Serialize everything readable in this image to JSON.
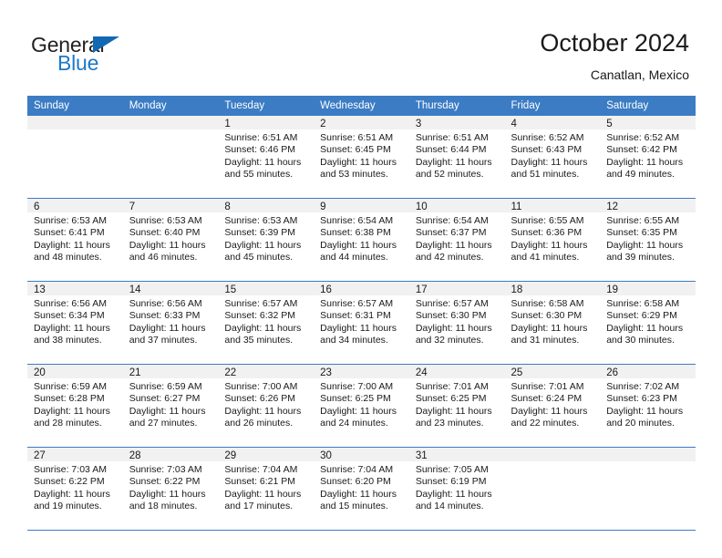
{
  "brand": {
    "name_part1": "General",
    "name_part2": "Blue",
    "triangle_icon": "triangle-icon",
    "accent_color": "#1268b3",
    "blue_text_color": "#1c78c8"
  },
  "header": {
    "title": "October 2024",
    "subtitle": "Canatlan, Mexico"
  },
  "theme": {
    "header_row_bg": "#3b7cc4",
    "date_strip_bg": "#f1f1f1",
    "row_divider": "#3b7cc4",
    "text_color": "#1a1a1a"
  },
  "weekdays": [
    "Sunday",
    "Monday",
    "Tuesday",
    "Wednesday",
    "Thursday",
    "Friday",
    "Saturday"
  ],
  "weeks": [
    [
      {
        "empty": true
      },
      {
        "empty": true
      },
      {
        "empty": false,
        "date": "1",
        "sunrise": "Sunrise: 6:51 AM",
        "sunset": "Sunset: 6:46 PM",
        "daylight_line1": "Daylight: 11 hours",
        "daylight_line2": "and 55 minutes."
      },
      {
        "empty": false,
        "date": "2",
        "sunrise": "Sunrise: 6:51 AM",
        "sunset": "Sunset: 6:45 PM",
        "daylight_line1": "Daylight: 11 hours",
        "daylight_line2": "and 53 minutes."
      },
      {
        "empty": false,
        "date": "3",
        "sunrise": "Sunrise: 6:51 AM",
        "sunset": "Sunset: 6:44 PM",
        "daylight_line1": "Daylight: 11 hours",
        "daylight_line2": "and 52 minutes."
      },
      {
        "empty": false,
        "date": "4",
        "sunrise": "Sunrise: 6:52 AM",
        "sunset": "Sunset: 6:43 PM",
        "daylight_line1": "Daylight: 11 hours",
        "daylight_line2": "and 51 minutes."
      },
      {
        "empty": false,
        "date": "5",
        "sunrise": "Sunrise: 6:52 AM",
        "sunset": "Sunset: 6:42 PM",
        "daylight_line1": "Daylight: 11 hours",
        "daylight_line2": "and 49 minutes."
      }
    ],
    [
      {
        "empty": false,
        "date": "6",
        "sunrise": "Sunrise: 6:53 AM",
        "sunset": "Sunset: 6:41 PM",
        "daylight_line1": "Daylight: 11 hours",
        "daylight_line2": "and 48 minutes."
      },
      {
        "empty": false,
        "date": "7",
        "sunrise": "Sunrise: 6:53 AM",
        "sunset": "Sunset: 6:40 PM",
        "daylight_line1": "Daylight: 11 hours",
        "daylight_line2": "and 46 minutes."
      },
      {
        "empty": false,
        "date": "8",
        "sunrise": "Sunrise: 6:53 AM",
        "sunset": "Sunset: 6:39 PM",
        "daylight_line1": "Daylight: 11 hours",
        "daylight_line2": "and 45 minutes."
      },
      {
        "empty": false,
        "date": "9",
        "sunrise": "Sunrise: 6:54 AM",
        "sunset": "Sunset: 6:38 PM",
        "daylight_line1": "Daylight: 11 hours",
        "daylight_line2": "and 44 minutes."
      },
      {
        "empty": false,
        "date": "10",
        "sunrise": "Sunrise: 6:54 AM",
        "sunset": "Sunset: 6:37 PM",
        "daylight_line1": "Daylight: 11 hours",
        "daylight_line2": "and 42 minutes."
      },
      {
        "empty": false,
        "date": "11",
        "sunrise": "Sunrise: 6:55 AM",
        "sunset": "Sunset: 6:36 PM",
        "daylight_line1": "Daylight: 11 hours",
        "daylight_line2": "and 41 minutes."
      },
      {
        "empty": false,
        "date": "12",
        "sunrise": "Sunrise: 6:55 AM",
        "sunset": "Sunset: 6:35 PM",
        "daylight_line1": "Daylight: 11 hours",
        "daylight_line2": "and 39 minutes."
      }
    ],
    [
      {
        "empty": false,
        "date": "13",
        "sunrise": "Sunrise: 6:56 AM",
        "sunset": "Sunset: 6:34 PM",
        "daylight_line1": "Daylight: 11 hours",
        "daylight_line2": "and 38 minutes."
      },
      {
        "empty": false,
        "date": "14",
        "sunrise": "Sunrise: 6:56 AM",
        "sunset": "Sunset: 6:33 PM",
        "daylight_line1": "Daylight: 11 hours",
        "daylight_line2": "and 37 minutes."
      },
      {
        "empty": false,
        "date": "15",
        "sunrise": "Sunrise: 6:57 AM",
        "sunset": "Sunset: 6:32 PM",
        "daylight_line1": "Daylight: 11 hours",
        "daylight_line2": "and 35 minutes."
      },
      {
        "empty": false,
        "date": "16",
        "sunrise": "Sunrise: 6:57 AM",
        "sunset": "Sunset: 6:31 PM",
        "daylight_line1": "Daylight: 11 hours",
        "daylight_line2": "and 34 minutes."
      },
      {
        "empty": false,
        "date": "17",
        "sunrise": "Sunrise: 6:57 AM",
        "sunset": "Sunset: 6:30 PM",
        "daylight_line1": "Daylight: 11 hours",
        "daylight_line2": "and 32 minutes."
      },
      {
        "empty": false,
        "date": "18",
        "sunrise": "Sunrise: 6:58 AM",
        "sunset": "Sunset: 6:30 PM",
        "daylight_line1": "Daylight: 11 hours",
        "daylight_line2": "and 31 minutes."
      },
      {
        "empty": false,
        "date": "19",
        "sunrise": "Sunrise: 6:58 AM",
        "sunset": "Sunset: 6:29 PM",
        "daylight_line1": "Daylight: 11 hours",
        "daylight_line2": "and 30 minutes."
      }
    ],
    [
      {
        "empty": false,
        "date": "20",
        "sunrise": "Sunrise: 6:59 AM",
        "sunset": "Sunset: 6:28 PM",
        "daylight_line1": "Daylight: 11 hours",
        "daylight_line2": "and 28 minutes."
      },
      {
        "empty": false,
        "date": "21",
        "sunrise": "Sunrise: 6:59 AM",
        "sunset": "Sunset: 6:27 PM",
        "daylight_line1": "Daylight: 11 hours",
        "daylight_line2": "and 27 minutes."
      },
      {
        "empty": false,
        "date": "22",
        "sunrise": "Sunrise: 7:00 AM",
        "sunset": "Sunset: 6:26 PM",
        "daylight_line1": "Daylight: 11 hours",
        "daylight_line2": "and 26 minutes."
      },
      {
        "empty": false,
        "date": "23",
        "sunrise": "Sunrise: 7:00 AM",
        "sunset": "Sunset: 6:25 PM",
        "daylight_line1": "Daylight: 11 hours",
        "daylight_line2": "and 24 minutes."
      },
      {
        "empty": false,
        "date": "24",
        "sunrise": "Sunrise: 7:01 AM",
        "sunset": "Sunset: 6:25 PM",
        "daylight_line1": "Daylight: 11 hours",
        "daylight_line2": "and 23 minutes."
      },
      {
        "empty": false,
        "date": "25",
        "sunrise": "Sunrise: 7:01 AM",
        "sunset": "Sunset: 6:24 PM",
        "daylight_line1": "Daylight: 11 hours",
        "daylight_line2": "and 22 minutes."
      },
      {
        "empty": false,
        "date": "26",
        "sunrise": "Sunrise: 7:02 AM",
        "sunset": "Sunset: 6:23 PM",
        "daylight_line1": "Daylight: 11 hours",
        "daylight_line2": "and 20 minutes."
      }
    ],
    [
      {
        "empty": false,
        "date": "27",
        "sunrise": "Sunrise: 7:03 AM",
        "sunset": "Sunset: 6:22 PM",
        "daylight_line1": "Daylight: 11 hours",
        "daylight_line2": "and 19 minutes."
      },
      {
        "empty": false,
        "date": "28",
        "sunrise": "Sunrise: 7:03 AM",
        "sunset": "Sunset: 6:22 PM",
        "daylight_line1": "Daylight: 11 hours",
        "daylight_line2": "and 18 minutes."
      },
      {
        "empty": false,
        "date": "29",
        "sunrise": "Sunrise: 7:04 AM",
        "sunset": "Sunset: 6:21 PM",
        "daylight_line1": "Daylight: 11 hours",
        "daylight_line2": "and 17 minutes."
      },
      {
        "empty": false,
        "date": "30",
        "sunrise": "Sunrise: 7:04 AM",
        "sunset": "Sunset: 6:20 PM",
        "daylight_line1": "Daylight: 11 hours",
        "daylight_line2": "and 15 minutes."
      },
      {
        "empty": false,
        "date": "31",
        "sunrise": "Sunrise: 7:05 AM",
        "sunset": "Sunset: 6:19 PM",
        "daylight_line1": "Daylight: 11 hours",
        "daylight_line2": "and 14 minutes."
      },
      {
        "empty": true
      },
      {
        "empty": true
      }
    ]
  ]
}
